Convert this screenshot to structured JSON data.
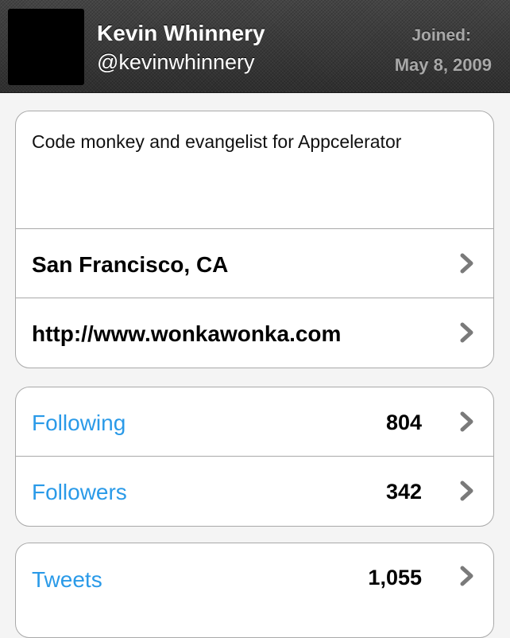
{
  "profile": {
    "name": "Kevin Whinnery",
    "handle": "@kevinwhinnery",
    "joined_label": "Joined:",
    "joined_date": "May 8, 2009"
  },
  "details": {
    "bio": "Code monkey and evangelist for Appcelerator",
    "location": "San Francisco, CA",
    "website": "http://www.wonkawonka.com"
  },
  "stats": {
    "following_label": "Following",
    "following_count": "804",
    "followers_label": "Followers",
    "followers_count": "342",
    "tweets_label": "Tweets",
    "tweets_count": "1,055"
  },
  "icons": {
    "chevron": "chevron-right-icon"
  },
  "colors": {
    "link_blue": "#2a9ae8",
    "header_bg": "#3a3a3a",
    "muted_text": "#a8a8a8"
  }
}
